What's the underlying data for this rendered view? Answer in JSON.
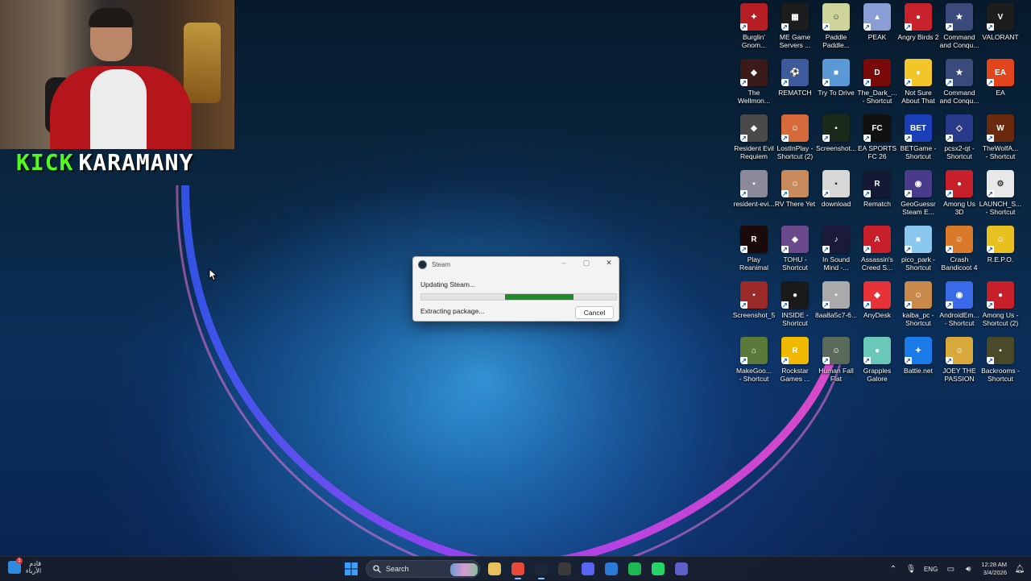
{
  "stream": {
    "brand_prefix": "KICK",
    "brand_name": "KARAMANY"
  },
  "desktop_icons": [
    {
      "label": "Burglin'\nGnom...",
      "color": "#b51f24",
      "glyph": "✦"
    },
    {
      "label": "ME Game\nServers ...",
      "color": "#1c1c1c",
      "glyph": "▦"
    },
    {
      "label": "Paddle\nPaddle...",
      "color": "#cfd49a",
      "glyph": "☺"
    },
    {
      "label": "PEAK",
      "color": "#8a9ed6",
      "glyph": "▲"
    },
    {
      "label": "Angry Birds 2",
      "color": "#c8232c",
      "glyph": "●"
    },
    {
      "label": "Command\nand Conqu...",
      "color": "#3a4a7a",
      "glyph": "★"
    },
    {
      "label": "VALORANT",
      "color": "#1d1d1d",
      "glyph": "V"
    },
    {
      "label": "The\nWellmon...",
      "color": "#3b1a1a",
      "glyph": "◆"
    },
    {
      "label": "REMATCH",
      "color": "#3d5a9c",
      "glyph": "⚽"
    },
    {
      "label": "Try To Drive",
      "color": "#5b98d6",
      "glyph": "■"
    },
    {
      "label": "The_Dark_...\n- Shortcut",
      "color": "#7a0a0a",
      "glyph": "D"
    },
    {
      "label": "Not Sure\nAbout That",
      "color": "#f2c628",
      "glyph": "●"
    },
    {
      "label": "Command\nand Conqu...",
      "color": "#3a4a7a",
      "glyph": "★"
    },
    {
      "label": "EA",
      "color": "#e2441c",
      "glyph": "EA"
    },
    {
      "label": "Resident Evil\nRequiem",
      "color": "#4a4a4a",
      "glyph": "◆"
    },
    {
      "label": "LostInPlay -\nShortcut (2)",
      "color": "#d66a3a",
      "glyph": "☺"
    },
    {
      "label": "Screenshot...",
      "color": "#1a2a1a",
      "glyph": "▪"
    },
    {
      "label": "EA SPORTS\nFC 26",
      "color": "#111111",
      "glyph": "FC"
    },
    {
      "label": "BETGame -\nShortcut",
      "color": "#1a3fb8",
      "glyph": "BET"
    },
    {
      "label": "pcsx2-qt -\nShortcut",
      "color": "#2a3a8a",
      "glyph": "◇"
    },
    {
      "label": "TheWolfA...\n- Shortcut",
      "color": "#6a2a10",
      "glyph": "W"
    },
    {
      "label": "resident-evi...",
      "color": "#8a8a9a",
      "glyph": "▪"
    },
    {
      "label": "RV There Yet",
      "color": "#c88a5a",
      "glyph": "☺"
    },
    {
      "label": "download",
      "color": "#d8d8d8",
      "glyph": "▪"
    },
    {
      "label": "Rematch",
      "color": "#141a34",
      "glyph": "R"
    },
    {
      "label": "GeoGuessr\nSteam E...",
      "color": "#4a3a8a",
      "glyph": "◉"
    },
    {
      "label": "Among Us\n3D",
      "color": "#c8202a",
      "glyph": "●"
    },
    {
      "label": "LAUNCH_S...\n- Shortcut",
      "color": "#e8e8e8",
      "glyph": "⚙"
    },
    {
      "label": "Play\nReanimal",
      "color": "#1a0a0a",
      "glyph": "R"
    },
    {
      "label": "TOHU -\nShortcut",
      "color": "#6a4a8a",
      "glyph": "◆"
    },
    {
      "label": "In Sound\nMind -...",
      "color": "#1a1a3a",
      "glyph": "♪"
    },
    {
      "label": "Assassin's\nCreed S...",
      "color": "#c8202a",
      "glyph": "A"
    },
    {
      "label": "pico_park -\nShortcut",
      "color": "#8ac8f0",
      "glyph": "■"
    },
    {
      "label": "Crash\nBandicoot 4",
      "color": "#d87a2a",
      "glyph": "☺"
    },
    {
      "label": "R.E.P.O.",
      "color": "#e8c020",
      "glyph": "☺"
    },
    {
      "label": "Screenshot_5",
      "color": "#9a2a2a",
      "glyph": "▪"
    },
    {
      "label": "INSIDE -\nShortcut",
      "color": "#1a1a1a",
      "glyph": "●"
    },
    {
      "label": "8aa8a5c7-6...",
      "color": "#aaaaaa",
      "glyph": "▪"
    },
    {
      "label": "AnyDesk",
      "color": "#e8323a",
      "glyph": "◆"
    },
    {
      "label": "kaiba_pc -\nShortcut",
      "color": "#c88a4a",
      "glyph": "☺"
    },
    {
      "label": "AndroidEm...\n- Shortcut",
      "color": "#3a6ae8",
      "glyph": "◉"
    },
    {
      "label": "Among Us -\nShortcut (2)",
      "color": "#c8202a",
      "glyph": "●"
    },
    {
      "label": "MakeGoo...\n- Shortcut",
      "color": "#5a7a3a",
      "glyph": "⌂"
    },
    {
      "label": "Rockstar\nGames ...",
      "color": "#f0b800",
      "glyph": "R"
    },
    {
      "label": "Human Fall\nFlat",
      "color": "#5a6a5a",
      "glyph": "☺"
    },
    {
      "label": "Grapples\nGalore",
      "color": "#6ac8b8",
      "glyph": "●"
    },
    {
      "label": "Battle.net",
      "color": "#1a7ae8",
      "glyph": "✦"
    },
    {
      "label": "JOEY THE\nPASSION",
      "color": "#d8a83a",
      "glyph": "☺"
    },
    {
      "label": "Backrooms -\nShortcut",
      "color": "#4a4a2a",
      "glyph": "▪"
    }
  ],
  "steam_dialog": {
    "title": "Steam",
    "status": "Updating Steam...",
    "substatus": "Extracting package...",
    "cancel_label": "Cancel",
    "progress_start": 0.43,
    "progress_end": 0.78
  },
  "taskbar": {
    "weather_line1": "قادم",
    "weather_line2": "الأرباء",
    "weather_badge": "1",
    "search_placeholder": "Search",
    "language": "ENG",
    "time": "12:28 AM",
    "date": "3/4/2026",
    "apps": [
      {
        "name": "file-explorer-icon",
        "color": "#e8c25a"
      },
      {
        "name": "chrome-icon",
        "color": "#e84a3a"
      },
      {
        "name": "steam-icon",
        "color": "#1b2838"
      },
      {
        "name": "xbox-icon",
        "color": "#3a3a3a"
      },
      {
        "name": "discord-icon",
        "color": "#5865f2"
      },
      {
        "name": "mail-icon",
        "color": "#2a7ad8"
      },
      {
        "name": "spotify-icon",
        "color": "#1db954"
      },
      {
        "name": "whatsapp-icon",
        "color": "#25d366"
      },
      {
        "name": "teams-icon",
        "color": "#5b5fc7"
      }
    ]
  }
}
